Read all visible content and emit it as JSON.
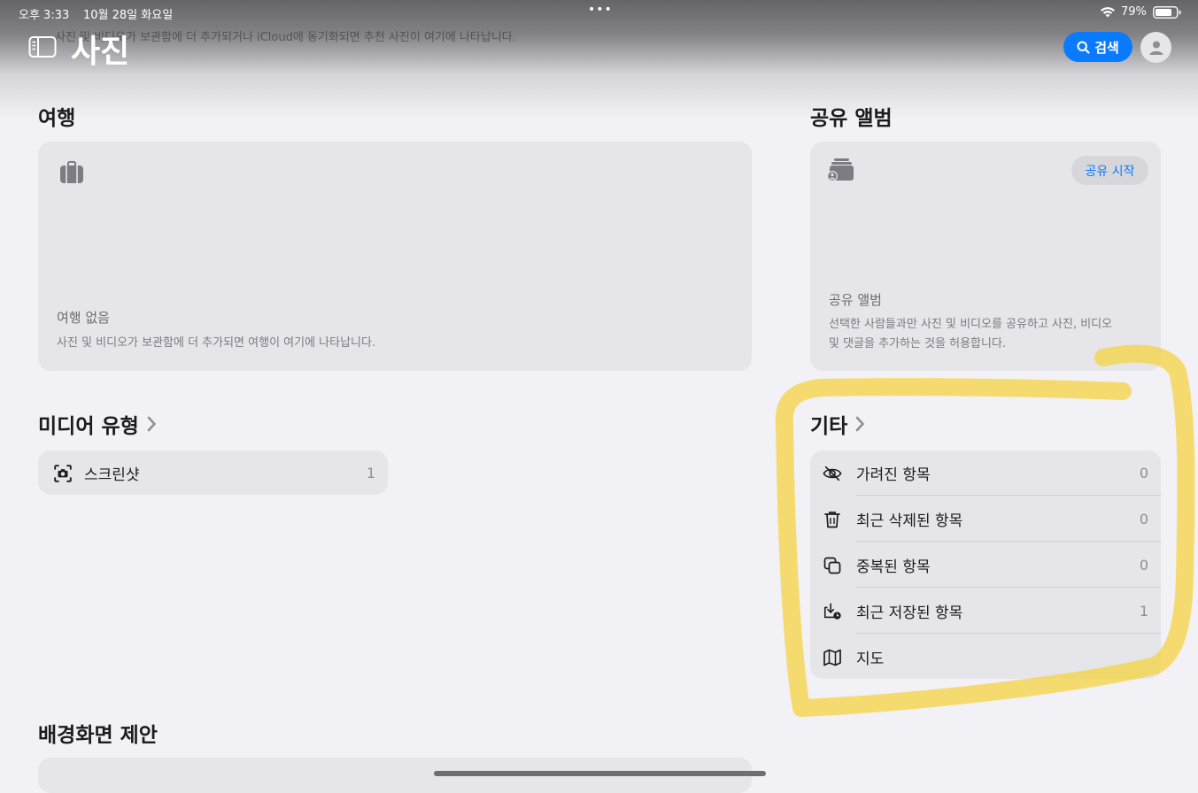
{
  "status_bar": {
    "time": "오후 3:33",
    "date": "10월 28일 화요일",
    "dots": "•••",
    "battery_percent": "79%"
  },
  "header": {
    "title": "사진",
    "ghost_text": "사진 및 비디오가 보관함에 더 추가되거나 iCloud에 동기화되면 추천 사진이 여기에 나타납니다.",
    "search_label": "검색"
  },
  "trips": {
    "section_title": "여행",
    "empty_title": "여행 없음",
    "empty_desc": "사진 및 비디오가 보관함에 더 추가되면 여행이 여기에 나타납니다."
  },
  "shared_albums": {
    "section_title": "공유 앨범",
    "start_button": "공유 시작",
    "card_title": "공유 앨범",
    "card_desc_line1": "선택한 사람들과만 사진 및 비디오를 공유하고 사진, 비디오",
    "card_desc_line2": "및 댓글을 추가하는 것을 허용합니다."
  },
  "media_types": {
    "section_title": "미디어 유형",
    "items": [
      {
        "label": "스크린샷",
        "count": "1",
        "icon": "screenshot-icon"
      }
    ]
  },
  "other": {
    "section_title": "기타",
    "items": [
      {
        "label": "가려진 항목",
        "count": "0",
        "icon": "eye-slash-icon"
      },
      {
        "label": "최근 삭제된 항목",
        "count": "0",
        "icon": "trash-icon"
      },
      {
        "label": "중복된 항목",
        "count": "0",
        "icon": "duplicate-icon"
      },
      {
        "label": "최근 저장된 항목",
        "count": "1",
        "icon": "download-icon"
      },
      {
        "label": "지도",
        "count": "",
        "icon": "map-icon"
      }
    ]
  },
  "wallpaper": {
    "section_title": "배경화면 제안"
  },
  "colors": {
    "accent": "#0a7aff",
    "highlight": "#f5d33a",
    "card": "#e5e5ea",
    "background": "#f2f1f6"
  }
}
